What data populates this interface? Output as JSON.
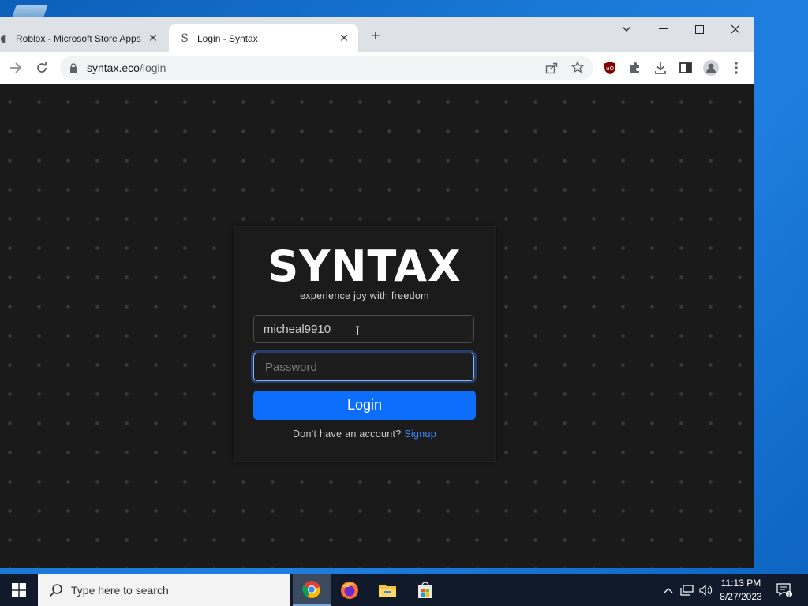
{
  "browser": {
    "tabs": [
      {
        "title": "Roblox - Microsoft Store Apps",
        "close": "✕"
      },
      {
        "title": "Login - Syntax",
        "close": "✕"
      }
    ],
    "new_tab": "+",
    "window_controls": {
      "tab_search": "⌄",
      "minimize": "—",
      "maximize": "☐",
      "close": "✕"
    },
    "address": {
      "domain": "syntax.eco",
      "path": "/login"
    }
  },
  "login": {
    "logo": "SYNTAX",
    "tagline": "experience joy with freedom",
    "username_value": "micheal9910",
    "password_placeholder": "Password",
    "login_button": "Login",
    "signup_prompt": "Don't have an account?",
    "signup_link": "Signup"
  },
  "taskbar": {
    "search_placeholder": "Type here to search",
    "time": "11:13 PM",
    "date": "8/27/2023",
    "notification_count": "1"
  },
  "colors": {
    "accent": "#0d6efd",
    "link": "#3d8bfd",
    "page_bg": "#1a1a1a",
    "taskbar": "#101a2a"
  },
  "icons": [
    "back-arrow-icon",
    "forward-arrow-icon",
    "reload-icon",
    "lock-icon",
    "share-icon",
    "star-icon",
    "ublock-icon",
    "extensions-icon",
    "download-icon",
    "sidepanel-icon",
    "profile-icon",
    "menu-dots-icon",
    "windows-start-icon",
    "search-icon",
    "chrome-icon",
    "firefox-icon",
    "file-explorer-icon",
    "store-icon",
    "chevron-up-icon",
    "network-icon",
    "volume-icon",
    "notification-icon"
  ]
}
